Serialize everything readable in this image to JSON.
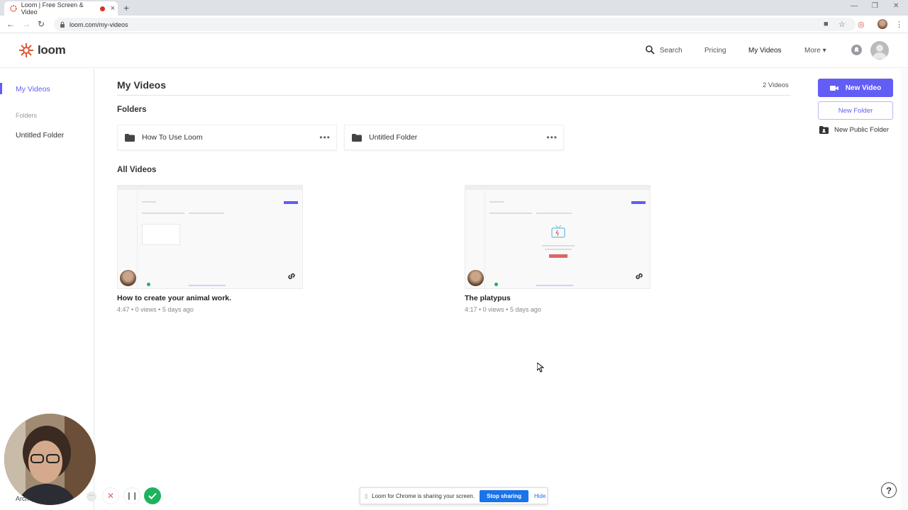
{
  "browser": {
    "tab_title": "Loom | Free Screen & Video",
    "new_tab_label": "+",
    "url": "loom.com/my-videos"
  },
  "header": {
    "logo_text": "loom",
    "search_label": "Search",
    "pricing_label": "Pricing",
    "my_videos_label": "My Videos",
    "more_label": "More"
  },
  "sidebar": {
    "active_label": "My Videos",
    "folders_heading": "Folders",
    "folder_item": "Untitled Folder"
  },
  "main": {
    "title": "My Videos",
    "video_count": "2 Videos",
    "folders_heading": "Folders",
    "folders": [
      {
        "name": "How To Use Loom"
      },
      {
        "name": "Untitled Folder"
      }
    ],
    "all_videos_heading": "All Videos",
    "videos": [
      {
        "title": "How to create your animal work.",
        "meta": "4:47 • 0 views • 5 days ago"
      },
      {
        "title": "The platypus",
        "meta": "4:17 • 0 views • 5 days ago"
      }
    ]
  },
  "actions": {
    "new_video": "New Video",
    "new_folder": "New Folder",
    "new_public_folder": "New Public Folder"
  },
  "recorder": {
    "label": "Arch"
  },
  "share_bar": {
    "grip": "||",
    "message": "Loom for Chrome is sharing your screen.",
    "stop_label": "Stop sharing",
    "hide_label": "Hide"
  },
  "help_label": "?",
  "colors": {
    "accent": "#625df5",
    "chrome_blue": "#1a73e8",
    "record_green": "#1fb35d",
    "record_red": "#e06666"
  }
}
